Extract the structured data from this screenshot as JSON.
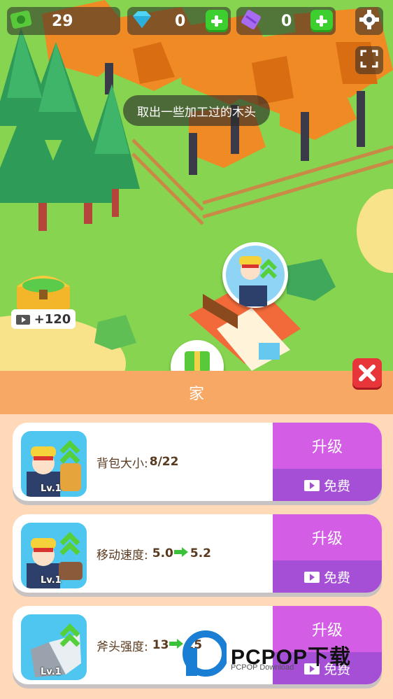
{
  "hud": {
    "cash": "29",
    "gems": "0",
    "tickets": "0"
  },
  "tooltip": "取出一些加工过的木头",
  "reward_chest": {
    "amount": "+120"
  },
  "panel": {
    "title": "家",
    "cards": [
      {
        "label": "背包大小:",
        "value": "8/22",
        "level": "Lv.1",
        "upgrade": "升级",
        "free": "免费"
      },
      {
        "label": "移动速度:",
        "value_from": "5.0",
        "value_to": "5.2",
        "level": "Lv.1",
        "upgrade": "升级",
        "free": "免费"
      },
      {
        "label": "斧头强度:",
        "value_from": "13",
        "value_to": "15",
        "level": "Lv.1",
        "upgrade": "升级",
        "free": "免费"
      }
    ]
  },
  "watermark": {
    "brand": "PCPOP下载",
    "sub": "PCPOP Download"
  },
  "colors": {
    "accent_purple": "#d45de6",
    "close_red": "#e8353a",
    "header_orange": "#f7a865"
  }
}
